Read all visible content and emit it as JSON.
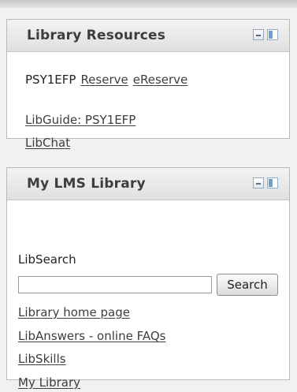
{
  "library_resources": {
    "title": "Library Resources",
    "course_code": "PSY1EFP",
    "reserve_link": "Reserve",
    "ereserve_link": "eReserve",
    "libguide_link": "LibGuide: PSY1EFP",
    "libchat_link": "LibChat"
  },
  "my_lms_library": {
    "title": "My LMS Library",
    "libsearch_label": "LibSearch",
    "search_input_value": "",
    "search_button": "Search",
    "links": [
      "Library home page",
      "LibAnswers - online FAQs",
      "LibSkills",
      "My Library"
    ]
  },
  "icons": {
    "minimize": "minimize-icon",
    "dock": "dock-panel-icon"
  }
}
